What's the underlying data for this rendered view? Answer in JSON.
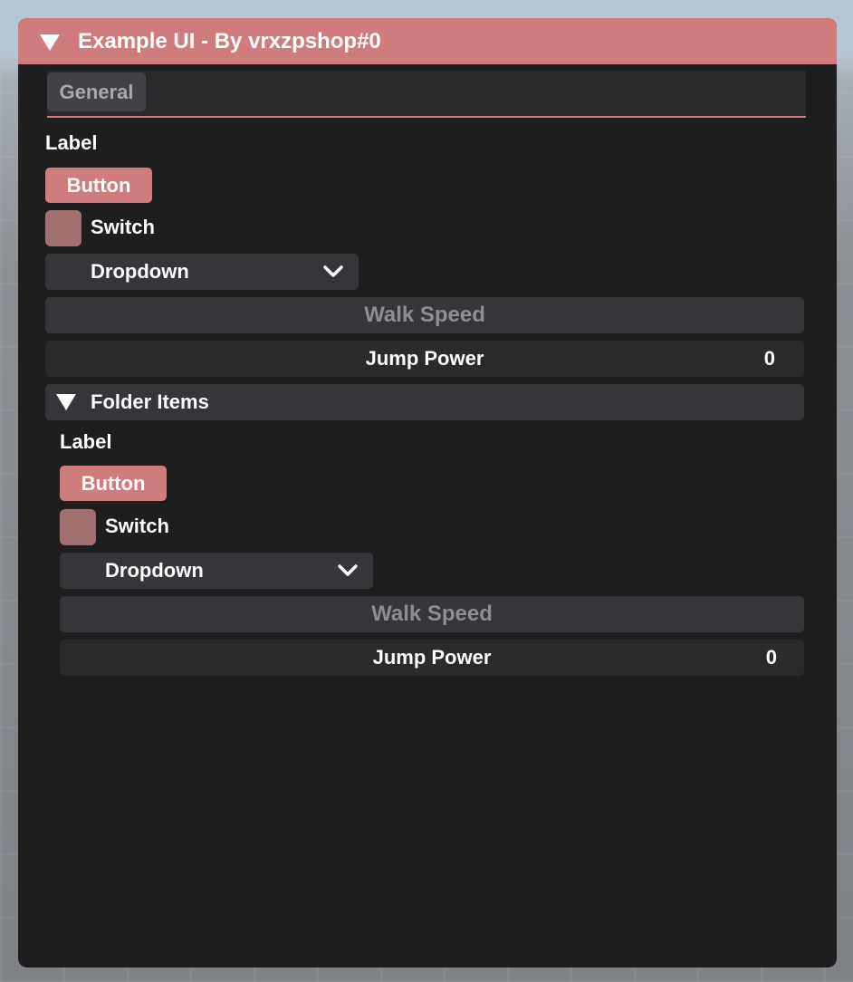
{
  "window": {
    "title": "Example UI - By vrxzpshop#0",
    "accent_color": "#ce7d7c",
    "background_color": "#1e1e1e",
    "collapse_icon": "triangle-down-icon"
  },
  "tabs": [
    {
      "label": "General",
      "active": true
    }
  ],
  "general": {
    "label": "Label",
    "button_label": "Button",
    "switch_label": "Switch",
    "switch_on": false,
    "dropdown_label": "Dropdown",
    "dropdown_icon": "chevron-down-icon",
    "slider_label": "Walk Speed",
    "number_label": "Jump Power",
    "number_value": "0"
  },
  "folder": {
    "title": "Folder Items",
    "expanded": true,
    "label": "Label",
    "button_label": "Button",
    "switch_label": "Switch",
    "switch_on": false,
    "dropdown_label": "Dropdown",
    "slider_label": "Walk Speed",
    "number_label": "Jump Power",
    "number_value": "0"
  }
}
